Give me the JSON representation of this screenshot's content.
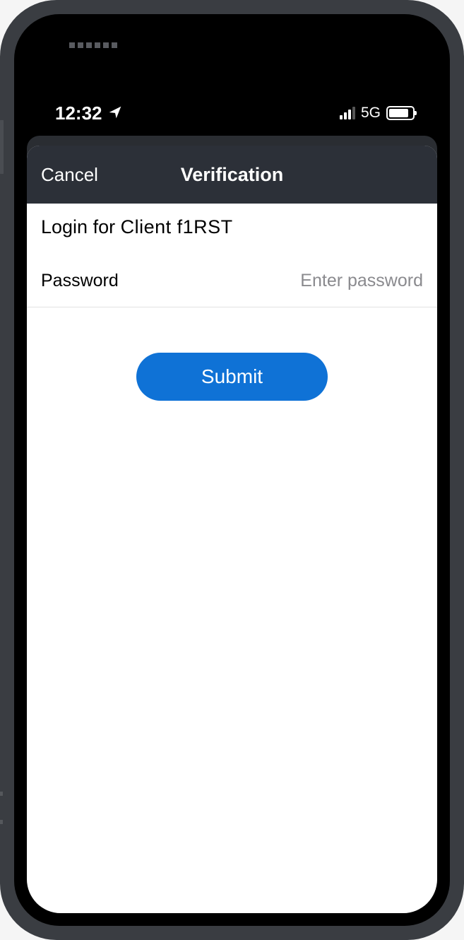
{
  "status": {
    "time": "12:32",
    "network_label": "5G"
  },
  "nav": {
    "cancel_label": "Cancel",
    "title": "Verification"
  },
  "subtitle": {
    "prefix": "Login for ",
    "app_name": "Client f1RST"
  },
  "form": {
    "password_label": "Password",
    "password_placeholder": "Enter password",
    "submit_label": "Submit"
  }
}
